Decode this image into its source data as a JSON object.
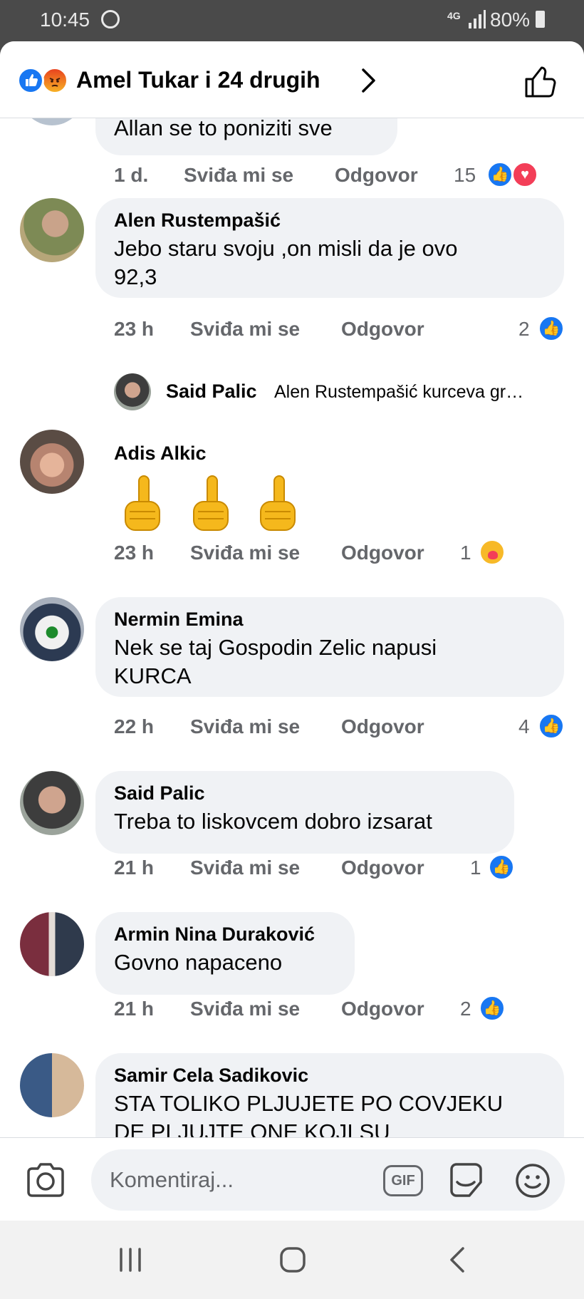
{
  "status_bar": {
    "time": "10:45",
    "network": "4G",
    "battery": "80%"
  },
  "header": {
    "title": "Amel Tukar i 24 drugih",
    "reactions": [
      "like-icon",
      "angry-icon"
    ]
  },
  "partial_comment": {
    "text": "Allan se to poniziti sve",
    "time": "1 d.",
    "like_label": "Sviđa mi se",
    "reply_label": "Odgovor",
    "reaction_count": "15",
    "reactions": [
      "like-icon",
      "love-icon"
    ]
  },
  "comments": [
    {
      "name": "Alen Rustempašić",
      "text_lines": [
        "Jebo staru svoju ,on misli da je ovo",
        "92,3"
      ],
      "time": "23 h",
      "like_label": "Sviđa mi se",
      "reply_label": "Odgovor",
      "reaction_count": "2",
      "reactions": [
        "like-icon"
      ],
      "reply": {
        "name": "Said Palic",
        "text": "Alen Rustempašić kurceva gr…"
      }
    },
    {
      "name": "Adis Alkic",
      "emoji": "☝☝☝",
      "time": "23 h",
      "like_label": "Sviđa mi se",
      "reply_label": "Odgovor",
      "reaction_count": "1",
      "reactions": [
        "care-icon"
      ]
    },
    {
      "name": "Nermin Emina",
      "text_lines": [
        "Nek se taj Gospodin Zelic napusi",
        "KURCA"
      ],
      "time": "22 h",
      "like_label": "Sviđa mi se",
      "reply_label": "Odgovor",
      "reaction_count": "4",
      "reactions": [
        "like-icon"
      ]
    },
    {
      "name": "Said Palic",
      "text_lines": [
        "Treba to liskovcem dobro izsarat"
      ],
      "time": "21 h",
      "like_label": "Sviđa mi se",
      "reply_label": "Odgovor",
      "reaction_count": "1",
      "reactions": [
        "like-icon"
      ]
    },
    {
      "name": "Armin Nina Duraković",
      "text_lines": [
        "Govno napaceno"
      ],
      "time": "21 h",
      "like_label": "Sviđa mi se",
      "reply_label": "Odgovor",
      "reaction_count": "2",
      "reactions": [
        "like-icon"
      ]
    },
    {
      "name": "Samir Cela Sadikovic",
      "text_lines": [
        "STA TOLIKO PLJUJETE PO COVJEKU",
        "DE PLJUJTE ONE KOJI SU"
      ]
    }
  ],
  "composer": {
    "placeholder": "Komentiraj...",
    "gif_label": "GIF"
  },
  "colors": {
    "accent": "#1877f2",
    "bubble": "#f0f2f5",
    "meta_text": "#65676b",
    "love": "#f33e58"
  },
  "icons": [
    "whatsapp-icon",
    "signal-icon",
    "battery-icon",
    "chevron-right-icon",
    "thumbs-up-icon",
    "camera-icon",
    "sticker-icon",
    "emoji-icon",
    "recent-apps-icon",
    "home-icon",
    "back-icon"
  ]
}
